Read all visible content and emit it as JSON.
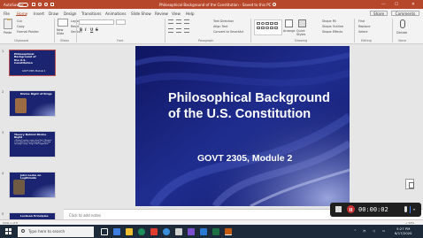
{
  "titlebar": {
    "autosave": "AutoSave",
    "toggle": "Off",
    "document_title": "Philosophical Background of the Constitution  -  Saved to this PC",
    "minimize": "—",
    "maximize": "☐",
    "close": "✕"
  },
  "tabs": [
    "File",
    "Home",
    "Insert",
    "Draw",
    "Design",
    "Transitions",
    "Animations",
    "Slide Show",
    "Review",
    "View",
    "Help"
  ],
  "share_label": "Share",
  "comments_label": "Comments",
  "ribbon": {
    "paste": "Paste",
    "cut": "Cut",
    "copy": "Copy",
    "format_painter": "Format Painter",
    "clipboard": "Clipboard",
    "new_slide": "New Slide",
    "layout": "Layout",
    "reset": "Reset",
    "section": "Section",
    "slides": "Slides",
    "font_name": "",
    "font_size": "",
    "bold": "B",
    "italic": "I",
    "underline": "U",
    "strike": "S",
    "font": "Font",
    "text_direction": "Text Direction",
    "align_text": "Align Text",
    "convert_smartart": "Convert to SmartArt",
    "paragraph": "Paragraph",
    "arrange": "Arrange",
    "quick_styles": "Quick Styles",
    "shape_fill": "Shape Fill",
    "shape_outline": "Shape Outline",
    "shape_effects": "Shape Effects",
    "drawing": "Drawing",
    "find": "Find",
    "replace": "Replace",
    "select": "Select",
    "editing": "Editing",
    "dictate": "Dictate",
    "voice": "Voice"
  },
  "thumbnails": [
    {
      "num": "1",
      "title": "Philosophical Background of the U.S. Constitution",
      "subtitle": "GOVT 2305, Module 2"
    },
    {
      "num": "2",
      "title": "Divine Right of Kings"
    },
    {
      "num": "3",
      "title": "Theory Behind Divine Right",
      "body": "• Monarch's power comes from God • Monarch is not subject to the will of people • Only God can judge a king • King is God's appointed"
    },
    {
      "num": "4",
      "title": "John Locke on Legitimate"
    },
    {
      "num": "5",
      "title": "Lockean Principles"
    }
  ],
  "slide": {
    "title": "Philosophical Background of the U.S. Constitution",
    "subtitle": "GOVT 2305, Module 2"
  },
  "notes_placeholder": "Click to add notes",
  "recording": {
    "time": "00:00:02"
  },
  "status": {
    "slide_info": "Slide 1 of 8",
    "zoom": "+ 53%"
  },
  "taskbar": {
    "search_placeholder": "Type here to search",
    "time": "5:27 PM",
    "date": "6/17/2020"
  }
}
